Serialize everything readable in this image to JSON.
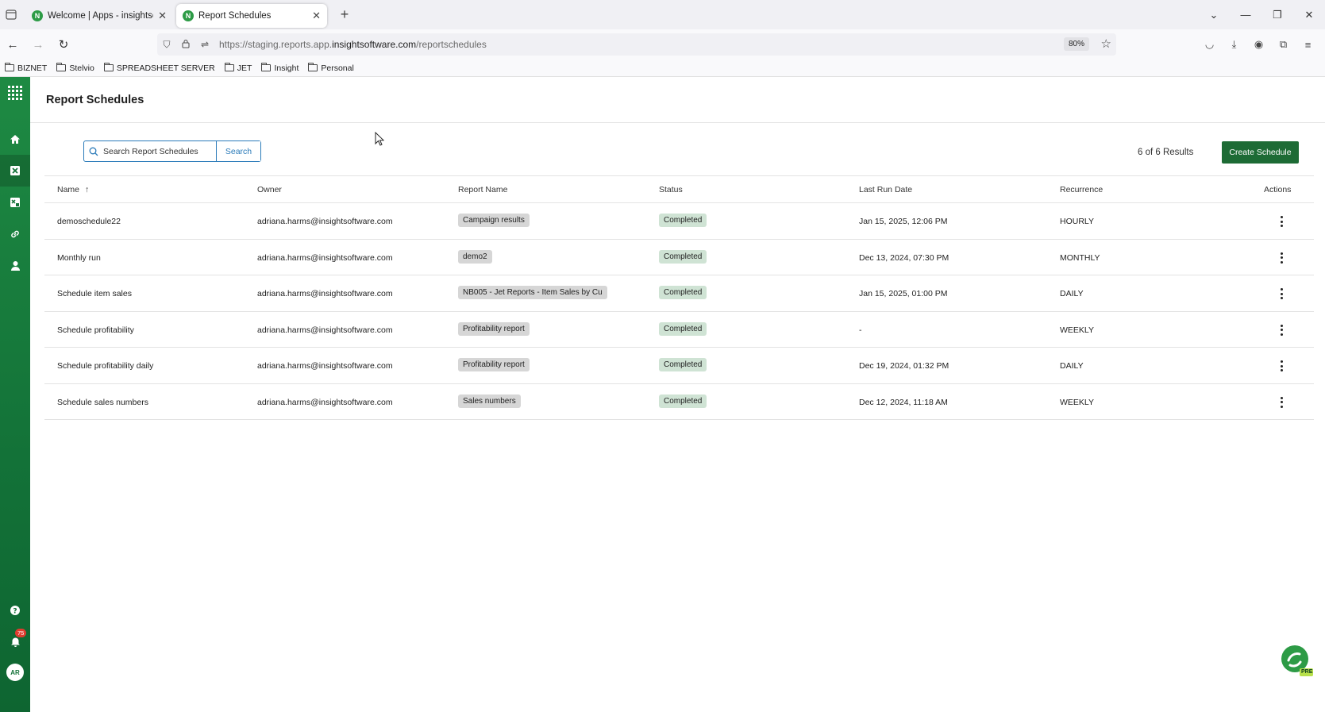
{
  "browser": {
    "tabs": [
      {
        "title": "Welcome | Apps - insightsoftware",
        "active": false
      },
      {
        "title": "Report Schedules",
        "active": true
      }
    ],
    "url_prefix": "https://staging.reports.app.",
    "url_domain": "insightsoftware.com",
    "url_path": "/reportschedules",
    "zoom": "80%",
    "bookmarks": [
      "BIZNET",
      "Stelvio",
      "SPREADSHEET SERVER",
      "JET",
      "Insight",
      "Personal"
    ]
  },
  "sidebar": {
    "notification_count": "75",
    "avatar_initials": "AR",
    "brand_color": "#137238"
  },
  "page": {
    "title": "Report Schedules",
    "search_placeholder": "Search Report Schedules",
    "search_button": "Search",
    "results_text": "6 of 6 Results",
    "create_button": "Create Schedule"
  },
  "table": {
    "columns": {
      "name": "Name",
      "owner": "Owner",
      "report": "Report Name",
      "status": "Status",
      "last_run": "Last Run Date",
      "recurrence": "Recurrence",
      "actions": "Actions"
    },
    "sort": {
      "column": "Name",
      "direction": "ascending"
    },
    "rows": [
      {
        "name": "demoschedule22",
        "owner": "adriana.harms@insightsoftware.com",
        "report": "Campaign results",
        "status": "Completed",
        "last_run": "Jan 15, 2025, 12:06 PM",
        "recurrence": "HOURLY"
      },
      {
        "name": "Monthly run",
        "owner": "adriana.harms@insightsoftware.com",
        "report": "demo2",
        "status": "Completed",
        "last_run": "Dec 13, 2024, 07:30 PM",
        "recurrence": "MONTHLY"
      },
      {
        "name": "Schedule item sales",
        "owner": "adriana.harms@insightsoftware.com",
        "report": "NB005 - Jet Reports - Item Sales by Cu",
        "status": "Completed",
        "last_run": "Jan 15, 2025, 01:00 PM",
        "recurrence": "DAILY"
      },
      {
        "name": "Schedule profitability",
        "owner": "adriana.harms@insightsoftware.com",
        "report": "Profitability report",
        "status": "Completed",
        "last_run": "-",
        "recurrence": "WEEKLY"
      },
      {
        "name": "Schedule profitability daily",
        "owner": "adriana.harms@insightsoftware.com",
        "report": "Profitability report",
        "status": "Completed",
        "last_run": "Dec 19, 2024, 01:32 PM",
        "recurrence": "DAILY"
      },
      {
        "name": "Schedule sales numbers",
        "owner": "adriana.harms@insightsoftware.com",
        "report": "Sales numbers",
        "status": "Completed",
        "last_run": "Dec 12, 2024, 11:18 AM",
        "recurrence": "WEEKLY"
      }
    ]
  },
  "corner_badge": "PRE"
}
